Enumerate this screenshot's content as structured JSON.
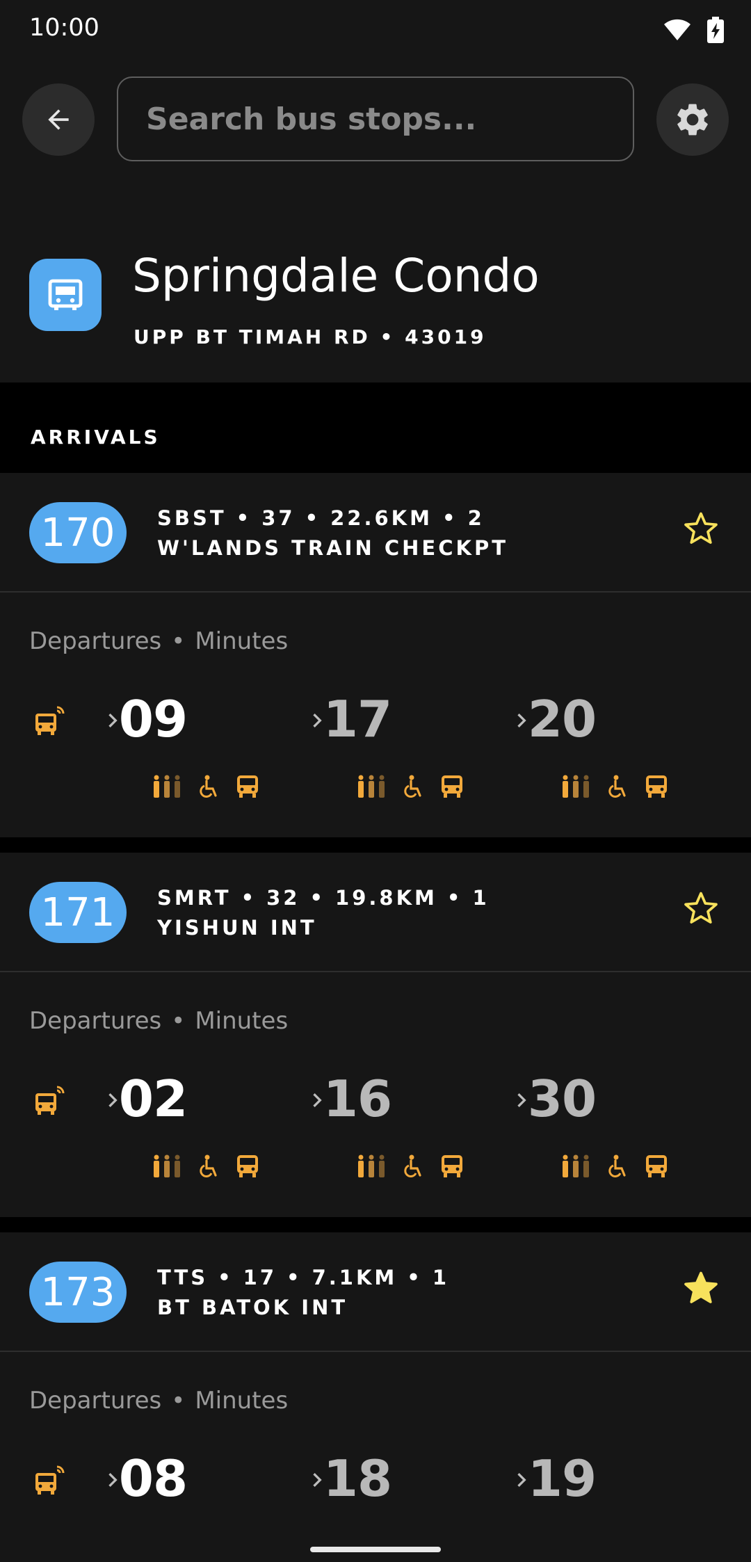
{
  "status_bar": {
    "time": "10:00",
    "icons": [
      "wifi-icon",
      "battery-charging-icon"
    ]
  },
  "search": {
    "placeholder": "Search bus stops..."
  },
  "stop": {
    "name": "Springdale Condo",
    "road": "UPP BT TIMAH RD",
    "code": "43019",
    "icon": "bus-stop-icon"
  },
  "section": {
    "arrivals_label": "ARRIVALS"
  },
  "labels": {
    "departures": "Departures",
    "minutes": "Minutes",
    "dot": "•"
  },
  "colors": {
    "accent_blue": "#55a9ef",
    "amber": "#f2a93b",
    "star_yellow": "#f7e15c",
    "card_bg": "#161616"
  },
  "services": [
    {
      "route": "170",
      "operator": "SBST",
      "stops": "37",
      "distance": "22.6KM",
      "direction": "2",
      "destination": "W'LANDS TRAIN CHECKPT",
      "favorite": false,
      "arrivals": [
        "09",
        "17",
        "20"
      ]
    },
    {
      "route": "171",
      "operator": "SMRT",
      "stops": "32",
      "distance": "19.8KM",
      "direction": "1",
      "destination": "YISHUN INT",
      "favorite": false,
      "arrivals": [
        "02",
        "16",
        "30"
      ]
    },
    {
      "route": "173",
      "operator": "TTS",
      "stops": "17",
      "distance": "7.1KM",
      "direction": "1",
      "destination": "BT BATOK INT",
      "favorite": true,
      "arrivals": [
        "08",
        "18",
        "19"
      ]
    }
  ]
}
